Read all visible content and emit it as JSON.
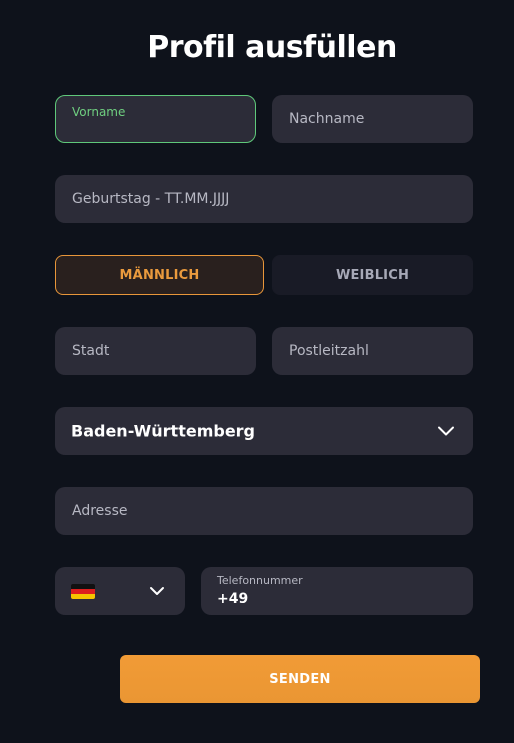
{
  "title": "Profil ausfüllen",
  "form": {
    "vorname": {
      "label": "Vorname",
      "value": ""
    },
    "nachname": {
      "placeholder": "Nachname"
    },
    "geburtstag": {
      "placeholder": "Geburtstag - TT.MM.JJJJ"
    },
    "gender": {
      "male": "MÄNNLICH",
      "female": "WEIBLICH",
      "selected": "MÄNNLICH"
    },
    "stadt": {
      "placeholder": "Stadt"
    },
    "postleitzahl": {
      "placeholder": "Postleitzahl"
    },
    "bundesland": {
      "value": "Baden-Württemberg"
    },
    "adresse": {
      "placeholder": "Adresse"
    },
    "country": {
      "flag_icon": "germany-flag-icon"
    },
    "telefon": {
      "label": "Telefonnummer",
      "value": "+49"
    },
    "submit_label": "SENDEN"
  },
  "colors": {
    "background": "#0e121b",
    "field": "#2c2c38",
    "accent_orange": "#ea9633",
    "focus_green": "#5fc87a"
  }
}
